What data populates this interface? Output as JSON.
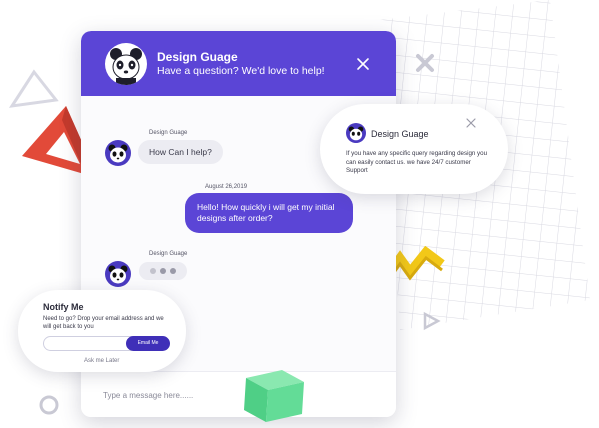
{
  "header": {
    "name": "Design Guage",
    "subtitle": "Have a question? We'd love to help!",
    "close_icon": "close-icon"
  },
  "messages": [
    {
      "sender": "Design Guage",
      "text": "How Can I help?",
      "direction": "incoming"
    },
    {
      "date": "August 26,2019",
      "text": "Hello! How quickly i will get my initial designs after order?",
      "direction": "outgoing"
    },
    {
      "sender": "Design Guage",
      "typing": true,
      "direction": "incoming"
    }
  ],
  "composer": {
    "placeholder": "Type a message here......"
  },
  "info_card": {
    "name": "Design Guage",
    "text": "If you have any specific query regarding design you can easily contact us. we have 24/7 customer Support"
  },
  "notify_card": {
    "title": "Notify Me",
    "text": "Need to go? Drop your email address and we will get back to you",
    "email_placeholder": "",
    "button_label": "Email Me",
    "later_label": "Ask me Later"
  },
  "colors": {
    "brand": "#5b45d6",
    "brand_dark": "#3f2fb8",
    "bubble_incoming": "#ececf2",
    "deco_triangle": "#e9493a",
    "deco_zigzag": "#f2c818",
    "deco_cube": "#5fdc93"
  }
}
